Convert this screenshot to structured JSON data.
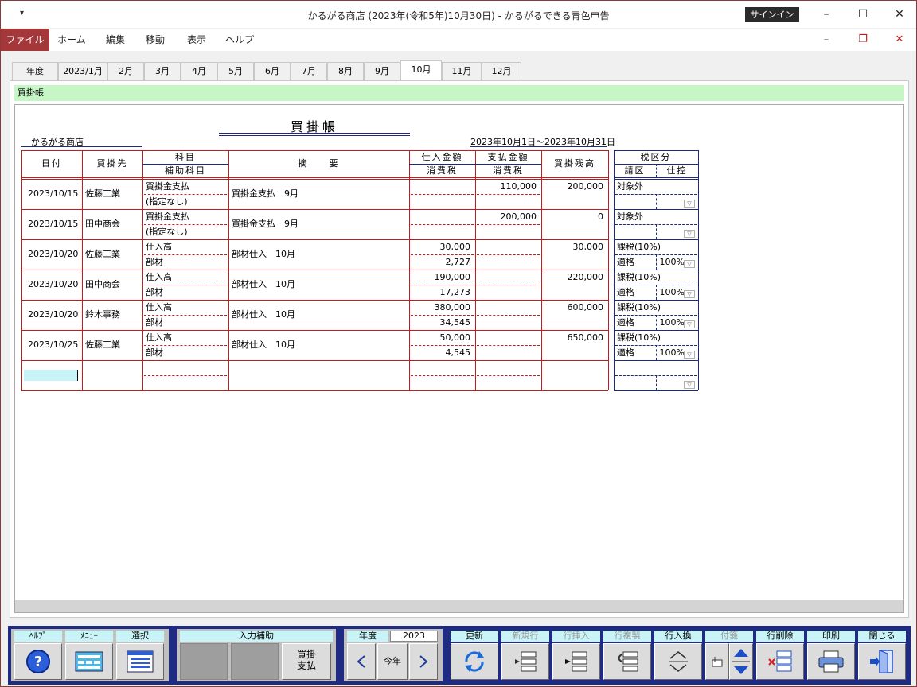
{
  "app": {
    "quick_access": "▾",
    "title": "かるがる商店 (2023年(令和5年)10月30日)  -  かるがるできる青色申告",
    "signin": "サインイン"
  },
  "menubar": {
    "items": [
      "ファイル",
      "ホーム",
      "編集",
      "移動",
      "表示",
      "ヘルプ"
    ]
  },
  "tabs": [
    "年度",
    "2023/1月",
    "2月",
    "3月",
    "4月",
    "5月",
    "6月",
    "7月",
    "8月",
    "9月",
    "10月",
    "11月",
    "12月"
  ],
  "subheader": "買掛帳",
  "ledger": {
    "title": "買掛帳",
    "shop": "かるがる商店",
    "period": "2023年10月1日～2023年10月31日",
    "headers": {
      "date": "日付",
      "partner": "買掛先",
      "account": "科目",
      "subaccount": "補助科目",
      "summary": "摘　　要",
      "purchase": "仕入金額",
      "tax1": "消費税",
      "payment": "支払金額",
      "tax2": "消費税",
      "balance": "買掛残高",
      "taxclass": "税区分",
      "taxkbn": "請区",
      "taxdeduct": "仕控"
    },
    "rows": [
      {
        "date": "2023/10/15",
        "partner": "佐藤工業",
        "account": "買掛金支払",
        "sub": "(指定なし)",
        "summary": "買掛金支払　9月",
        "purchase": "",
        "tax": "",
        "payment": "110,000",
        "balance": "200,000",
        "tax_class": "対象外",
        "tax_kbn": "",
        "tax_rate": ""
      },
      {
        "date": "2023/10/15",
        "partner": "田中商会",
        "account": "買掛金支払",
        "sub": "(指定なし)",
        "summary": "買掛金支払　9月",
        "purchase": "",
        "tax": "",
        "payment": "200,000",
        "balance": "0",
        "tax_class": "対象外",
        "tax_kbn": "",
        "tax_rate": ""
      },
      {
        "date": "2023/10/20",
        "partner": "佐藤工業",
        "account": "仕入高",
        "sub": "部材",
        "summary": "部材仕入　10月",
        "purchase": "30,000",
        "tax": "2,727",
        "payment": "",
        "balance": "30,000",
        "tax_class": "課税(10%)",
        "tax_kbn": "適格",
        "tax_rate": "100%"
      },
      {
        "date": "2023/10/20",
        "partner": "田中商会",
        "account": "仕入高",
        "sub": "部材",
        "summary": "部材仕入　10月",
        "purchase": "190,000",
        "tax": "17,273",
        "payment": "",
        "balance": "220,000",
        "tax_class": "課税(10%)",
        "tax_kbn": "適格",
        "tax_rate": "100%"
      },
      {
        "date": "2023/10/20",
        "partner": "鈴木事務",
        "account": "仕入高",
        "sub": "部材",
        "summary": "部材仕入　10月",
        "purchase": "380,000",
        "tax": "34,545",
        "payment": "",
        "balance": "600,000",
        "tax_class": "課税(10%)",
        "tax_kbn": "適格",
        "tax_rate": "100%"
      },
      {
        "date": "2023/10/25",
        "partner": "佐藤工業",
        "account": "仕入高",
        "sub": "部材",
        "summary": "部材仕入　10月",
        "purchase": "50,000",
        "tax": "4,545",
        "payment": "",
        "balance": "650,000",
        "tax_class": "課税(10%)",
        "tax_kbn": "適格",
        "tax_rate": "100%"
      }
    ]
  },
  "toolbar": {
    "help": "ﾍﾙﾌﾟ",
    "menu": "ﾒﾆｭｰ",
    "select": "選択",
    "input_assist": "入力補助",
    "assist_btn": "買掛\n支払",
    "year_label": "年度",
    "year_value": "2023",
    "this_year": "今年",
    "update": "更新",
    "new_row": "新規行",
    "insert_row": "行挿入",
    "copy_row": "行複製",
    "swap_row": "行入換",
    "tag": "付箋",
    "delete_row": "行削除",
    "print": "印刷",
    "close": "閉じる"
  },
  "colors": {
    "accent": "#a4373a",
    "grid_red": "#c41c1c",
    "header_navy": "#1b2a80",
    "subheader_green": "#c6f5c6",
    "toolbar_navy": "#1f2a82",
    "label_cyan": "#c8f4f8"
  }
}
